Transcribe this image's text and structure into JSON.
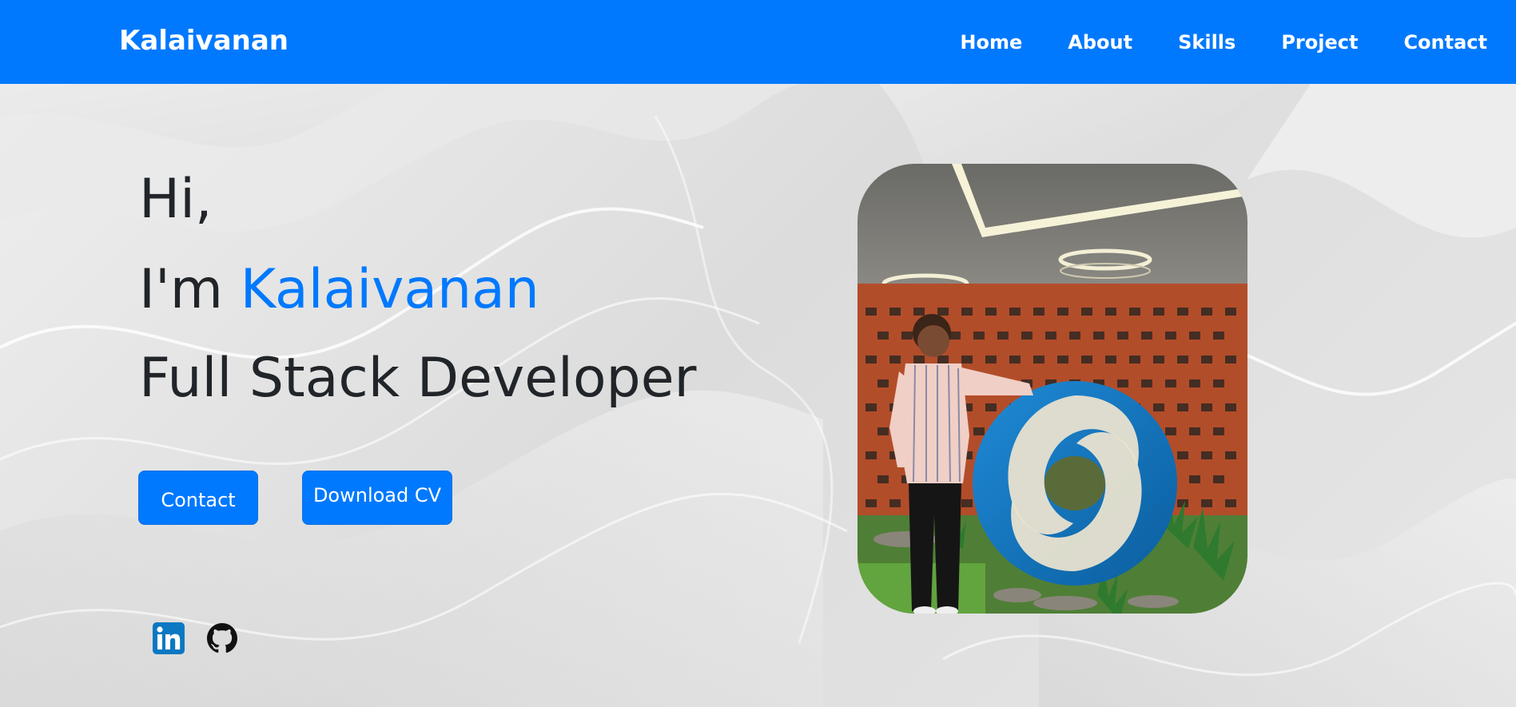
{
  "navbar": {
    "brand": "Kalaivanan",
    "links": [
      "Home",
      "About",
      "Skills",
      "Project",
      "Contact"
    ]
  },
  "hero": {
    "greeting": "Hi,",
    "intro_prefix": "I'm ",
    "name": "Kalaivanan",
    "role": "Full Stack Developer",
    "contact_button": "Contact",
    "cv_button": "Download CV"
  },
  "social": {
    "linkedin_icon": "linkedin-icon",
    "github_icon": "github-icon"
  },
  "colors": {
    "brand_blue": "#0079fe",
    "text_dark": "#212529",
    "background": "#e4e4e4"
  }
}
